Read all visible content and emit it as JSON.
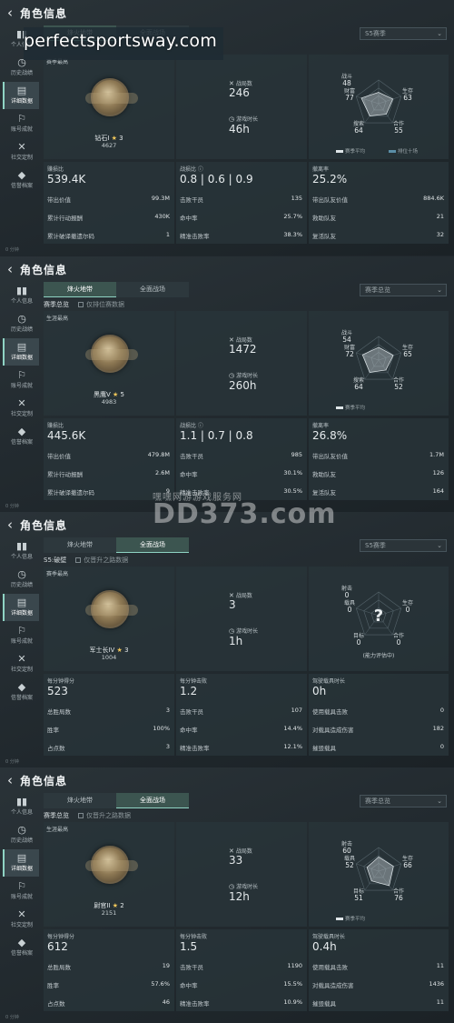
{
  "watermarks": {
    "top": "perfectsportsway.com",
    "brand_cn": "嘿嘿网游游戏服务网",
    "brand": "DD373.com"
  },
  "common": {
    "title": "角色信息",
    "sidebar": [
      "个人信息",
      "历史战绩",
      "详细数据",
      "账号成就",
      "社交定制",
      "信誉档案"
    ],
    "sidebar_icons": [
      "bar-chart-icon",
      "history-icon",
      "folder-icon",
      "achievement-icon",
      "tools-icon",
      "shield-icon"
    ],
    "tabs": [
      "烽火地带",
      "全面战场"
    ],
    "label_total_games": "战局数",
    "label_play_time": "游戏时长"
  },
  "panels": [
    {
      "active_tab": 0,
      "filter": "",
      "filter_opt": "",
      "dropdown": "S5赛季",
      "best_label": "赛季最高",
      "rank_name": "钻石I",
      "rank_stars": "3",
      "rank_points": "4627",
      "total_games": "246",
      "play_time": "46h",
      "radar": {
        "labels": [
          "战斗",
          "生存",
          "合作",
          "搜索",
          "财富"
        ],
        "values": [
          "48",
          "63",
          "55",
          "64",
          "77"
        ],
        "legend": [
          "赛季平均",
          "排位十场"
        ],
        "unknown": false,
        "note": ""
      },
      "stats": [
        {
          "header": "赚损比",
          "big": "539.4K",
          "rows": [
            [
              "带出价值",
              "99.3M"
            ],
            [
              "累计行动报酬",
              "430K"
            ],
            [
              "累计破译撤遗尔码",
              "1"
            ]
          ]
        },
        {
          "header": "战损比 ⓘ",
          "big": "0.8 | 0.6 | 0.9",
          "rows": [
            [
              "击败干员",
              "135"
            ],
            [
              "命中率",
              "25.7%"
            ],
            [
              "精准击败率",
              "38.3%"
            ]
          ]
        },
        {
          "header": "撤离率",
          "big": "25.2%",
          "rows": [
            [
              "带出队友价值",
              "884.6K"
            ],
            [
              "救助队友",
              "21"
            ],
            [
              "复活队友",
              "32"
            ]
          ]
        }
      ],
      "footer": "0 分钟"
    },
    {
      "active_tab": 0,
      "filter": "赛季总览",
      "filter_opt": "仅排位赛数据",
      "dropdown": "赛季总览",
      "best_label": "生涯最高",
      "rank_name": "黑鹰V",
      "rank_stars": "5",
      "rank_points": "4983",
      "total_games": "1472",
      "play_time": "260h",
      "radar": {
        "labels": [
          "战斗",
          "生存",
          "合作",
          "搜索",
          "财富"
        ],
        "values": [
          "54",
          "65",
          "52",
          "64",
          "72"
        ],
        "legend": [
          "赛季平均"
        ],
        "unknown": false,
        "note": ""
      },
      "stats": [
        {
          "header": "赚损比",
          "big": "445.6K",
          "rows": [
            [
              "带出价值",
              "479.8M"
            ],
            [
              "累计行动报酬",
              "2.6M"
            ],
            [
              "累计破译撤遗尔码",
              "9"
            ]
          ]
        },
        {
          "header": "战损比 ⓘ",
          "big": "1.1 | 0.7 | 0.8",
          "rows": [
            [
              "击败干员",
              "985"
            ],
            [
              "命中率",
              "30.1%"
            ],
            [
              "精准击败率",
              "30.5%"
            ]
          ]
        },
        {
          "header": "撤离率",
          "big": "26.8%",
          "rows": [
            [
              "带出队友价值",
              "1.7M"
            ],
            [
              "救助队友",
              "126"
            ],
            [
              "复活队友",
              "164"
            ]
          ]
        }
      ],
      "footer": "0 分钟"
    },
    {
      "active_tab": 1,
      "filter": "S5:破壁",
      "filter_opt": "仅晋升之路数据",
      "dropdown": "S5赛季",
      "best_label": "赛季最高",
      "rank_name": "军士长IV",
      "rank_stars": "3",
      "rank_points": "1004",
      "total_games": "3",
      "play_time": "1h",
      "radar": {
        "labels": [
          "射击",
          "生存",
          "合作",
          "目标",
          "载具"
        ],
        "values": [
          "0",
          "0",
          "0",
          "0",
          "0"
        ],
        "legend": [],
        "unknown": true,
        "note": "(能力评估中)"
      },
      "stats": [
        {
          "header": "每分钟得分",
          "big": "523",
          "rows": [
            [
              "总胜局数",
              "3"
            ],
            [
              "胜率",
              "100%"
            ],
            [
              "占点数",
              "3"
            ]
          ]
        },
        {
          "header": "每分钟击败",
          "big": "1.2",
          "rows": [
            [
              "击败干员",
              "107"
            ],
            [
              "命中率",
              "14.4%"
            ],
            [
              "精准击败率",
              "12.1%"
            ]
          ]
        },
        {
          "header": "驾驶载具时长",
          "big": "0h",
          "rows": [
            [
              "使用载具击败",
              "0"
            ],
            [
              "对载具造成伤害",
              "182"
            ],
            [
              "摧毁载具",
              "0"
            ]
          ]
        }
      ],
      "footer": "0 分钟"
    },
    {
      "active_tab": 1,
      "filter": "赛季总览",
      "filter_opt": "仅晋升之路数据",
      "dropdown": "赛季总览",
      "best_label": "生涯最高",
      "rank_name": "尉官II",
      "rank_stars": "2",
      "rank_points": "2151",
      "total_games": "33",
      "play_time": "12h",
      "radar": {
        "labels": [
          "射击",
          "生存",
          "合作",
          "目标",
          "载具"
        ],
        "values": [
          "60",
          "66",
          "76",
          "51",
          "52"
        ],
        "legend": [
          "赛季平均"
        ],
        "unknown": false,
        "note": ""
      },
      "stats": [
        {
          "header": "每分钟得分",
          "big": "612",
          "rows": [
            [
              "总胜局数",
              "19"
            ],
            [
              "胜率",
              "57.6%"
            ],
            [
              "占点数",
              "46"
            ]
          ]
        },
        {
          "header": "每分钟击败",
          "big": "1.5",
          "rows": [
            [
              "击败干员",
              "1190"
            ],
            [
              "命中率",
              "15.5%"
            ],
            [
              "精准击败率",
              "10.9%"
            ]
          ]
        },
        {
          "header": "驾驶载具时长",
          "big": "0.4h",
          "rows": [
            [
              "使用载具击败",
              "11"
            ],
            [
              "对载具造成伤害",
              "1436"
            ],
            [
              "摧毁载具",
              "11"
            ]
          ]
        }
      ],
      "footer": "0 分钟"
    }
  ]
}
